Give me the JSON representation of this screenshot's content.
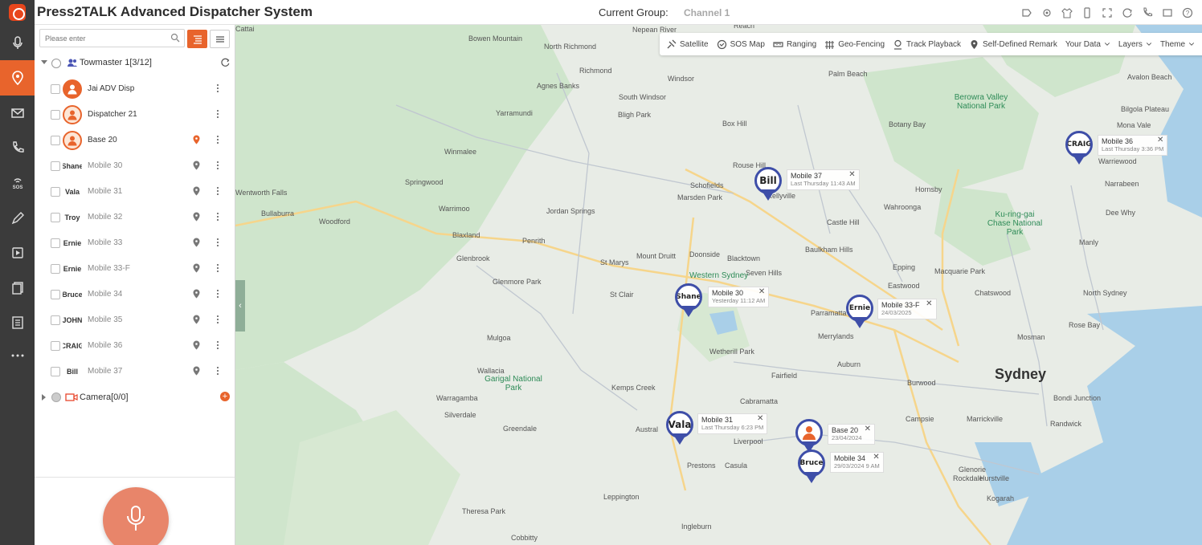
{
  "app": {
    "title": "Press2TALK Advanced Dispatcher System",
    "current_group_label": "Current Group:",
    "current_group_value": "Channel 1"
  },
  "rail": {
    "items": [
      "microphone-icon",
      "location-pin-icon",
      "mail-icon",
      "call-icon",
      "sos-icon",
      "pen-icon",
      "video-icon",
      "documents-icon",
      "list-icon",
      "more-icon"
    ],
    "sos_text": "SOS"
  },
  "header_icons": [
    "tag-icon",
    "settings-icon",
    "shirt-icon",
    "mobile-icon",
    "fullscreen-icon",
    "refresh-icon",
    "phone-icon",
    "window-icon",
    "help-icon"
  ],
  "panel": {
    "search_placeholder": "Please enter",
    "group_name": "Towmaster 1[3/12]",
    "members": [
      {
        "name": "Jai ADV Disp",
        "avatar": "",
        "online": true,
        "style": "orange"
      },
      {
        "name": "Dispatcher 21",
        "avatar": "",
        "online": true,
        "style": "ring"
      },
      {
        "name": "Base 20",
        "avatar": "",
        "online": true,
        "style": "ring",
        "pin_color": "#e8642c"
      },
      {
        "name": "Mobile 30",
        "avatar": "Shane",
        "online": false
      },
      {
        "name": "Mobile 31",
        "avatar": "Vala",
        "online": false
      },
      {
        "name": "Mobile 32",
        "avatar": "Troy",
        "online": false
      },
      {
        "name": "Mobile 33",
        "avatar": "Ernie",
        "online": false
      },
      {
        "name": "Mobile 33-F",
        "avatar": "Ernie",
        "online": false
      },
      {
        "name": "Mobile 34",
        "avatar": "Bruce",
        "online": false
      },
      {
        "name": "Mobile 35",
        "avatar": "JOHN",
        "online": false
      },
      {
        "name": "Mobile 36",
        "avatar": "CRAIG",
        "online": false
      },
      {
        "name": "Mobile 37",
        "avatar": "Bill",
        "online": false
      }
    ],
    "camera_label": "Camera[0/0]"
  },
  "toolbar": {
    "items": [
      "Satellite",
      "SOS Map",
      "Ranging",
      "Geo-Fencing",
      "Track Playback",
      "Self-Defined Remark",
      "Your Data",
      "Layers",
      "Theme"
    ]
  },
  "map": {
    "labels": [
      {
        "text": "Sydney",
        "big": true
      },
      {
        "text": "Bowen Mountain"
      },
      {
        "text": "North Richmond"
      },
      {
        "text": "Richmond"
      },
      {
        "text": "Agnes Banks"
      },
      {
        "text": "Windsor"
      },
      {
        "text": "South Windsor"
      },
      {
        "text": "Yarramundi"
      },
      {
        "text": "Bligh Park"
      },
      {
        "text": "Winmalee"
      },
      {
        "text": "Box Hill"
      },
      {
        "text": "Rouse Hill"
      },
      {
        "text": "Schofields"
      },
      {
        "text": "Marsden Park"
      },
      {
        "text": "Kellyville"
      },
      {
        "text": "Castle Hill"
      },
      {
        "text": "Springwood"
      },
      {
        "text": "Warrimoo"
      },
      {
        "text": "Woodford"
      },
      {
        "text": "Bullaburra"
      },
      {
        "text": "Wentworth Falls"
      },
      {
        "text": "Jordan Springs"
      },
      {
        "text": "Blaxland"
      },
      {
        "text": "Penrith"
      },
      {
        "text": "Glenbrook"
      },
      {
        "text": "St Marys"
      },
      {
        "text": "Mount Druitt"
      },
      {
        "text": "Doonside"
      },
      {
        "text": "Blacktown"
      },
      {
        "text": "Seven Hills"
      },
      {
        "text": "Glenmore Park"
      },
      {
        "text": "St Clair"
      },
      {
        "text": "Western Sydney",
        "park": true
      },
      {
        "text": "Baulkham Hills"
      },
      {
        "text": "Hornsby"
      },
      {
        "text": "Wahroonga"
      },
      {
        "text": "Epping"
      },
      {
        "text": "Eastwood"
      },
      {
        "text": "Macquarie Park"
      },
      {
        "text": "Chatswood"
      },
      {
        "text": "Parramatta"
      },
      {
        "text": "Merrylands"
      },
      {
        "text": "Mulgoa"
      },
      {
        "text": "Wallacia"
      },
      {
        "text": "Wetherill Park"
      },
      {
        "text": "Fairfield"
      },
      {
        "text": "Auburn"
      },
      {
        "text": "Burwood"
      },
      {
        "text": "Kemps Creek"
      },
      {
        "text": "Warragamba"
      },
      {
        "text": "Silverdale"
      },
      {
        "text": "Cabramatta"
      },
      {
        "text": "Greendale"
      },
      {
        "text": "Austral"
      },
      {
        "text": "Liverpool"
      },
      {
        "text": "Prestons"
      },
      {
        "text": "Casula"
      },
      {
        "text": "Leppington"
      },
      {
        "text": "Theresa Park"
      },
      {
        "text": "Cobbitty"
      },
      {
        "text": "Ingleburn"
      },
      {
        "text": "Campsie"
      },
      {
        "text": "Marrickville"
      },
      {
        "text": "Randwick"
      },
      {
        "text": "Bondi Junction"
      },
      {
        "text": "Rose Bay"
      },
      {
        "text": "Mosman"
      },
      {
        "text": "North Sydney"
      },
      {
        "text": "Manly"
      },
      {
        "text": "Dee Why"
      },
      {
        "text": "Narrabeen"
      },
      {
        "text": "Warriewood"
      },
      {
        "text": "Mona Vale"
      },
      {
        "text": "Bilgola Plateau"
      },
      {
        "text": "Avalon Beach"
      },
      {
        "text": "Palm Beach"
      },
      {
        "text": "Glenorie"
      },
      {
        "text": "Rockdale"
      },
      {
        "text": "Hurstville"
      },
      {
        "text": "Kogarah"
      },
      {
        "text": "Botany Bay"
      },
      {
        "text": "Berowra Valley National Park",
        "park": true
      },
      {
        "text": "Ku-ring-gai Chase National Park",
        "park": true
      },
      {
        "text": "Garigal National Park",
        "park": true
      },
      {
        "text": "Nepean River"
      },
      {
        "text": "Reach"
      },
      {
        "text": "Cattai"
      }
    ],
    "markers": [
      {
        "avatar": "Bill",
        "name": "Mobile 37",
        "time": "Last Thursday 11:43 AM"
      },
      {
        "avatar": "Shane",
        "name": "Mobile 30",
        "time": "Yesterday 11:12 AM"
      },
      {
        "avatar": "Ernie",
        "name": "Mobile 33-F",
        "time": "24/03/2025"
      },
      {
        "avatar": "CRAIG",
        "name": "Mobile 36",
        "time": "Last Thursday 3:36 PM"
      },
      {
        "avatar": "Vala",
        "name": "Mobile 31",
        "time": "Last Thursday 6:23 PM"
      },
      {
        "avatar": "",
        "name": "Base 20",
        "time": "23/04/2024"
      },
      {
        "avatar": "Bruce",
        "name": "Mobile 34",
        "time": "29/03/2024 9 AM"
      }
    ],
    "close_glyph": "✕",
    "collapse_glyph": "‹"
  },
  "colors": {
    "accent": "#e8642c",
    "rail_bg": "#3b3b3b",
    "marker_blue": "#3e4ea8"
  }
}
